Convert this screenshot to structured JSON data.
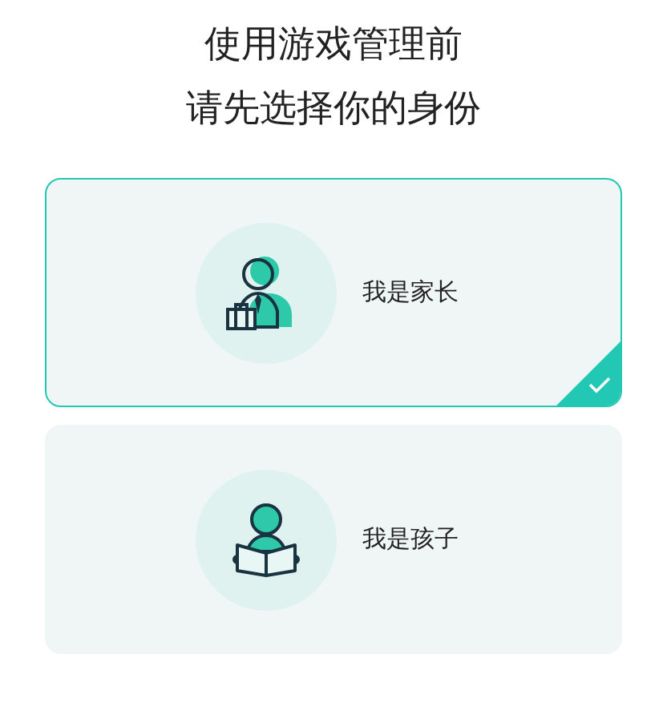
{
  "title_lines": [
    "使用游戏管理前",
    "请先选择你的身份"
  ],
  "roles": [
    {
      "kind": "parent",
      "label": "我是家长",
      "selected": true
    },
    {
      "kind": "child",
      "label": "我是孩子",
      "selected": false
    }
  ]
}
